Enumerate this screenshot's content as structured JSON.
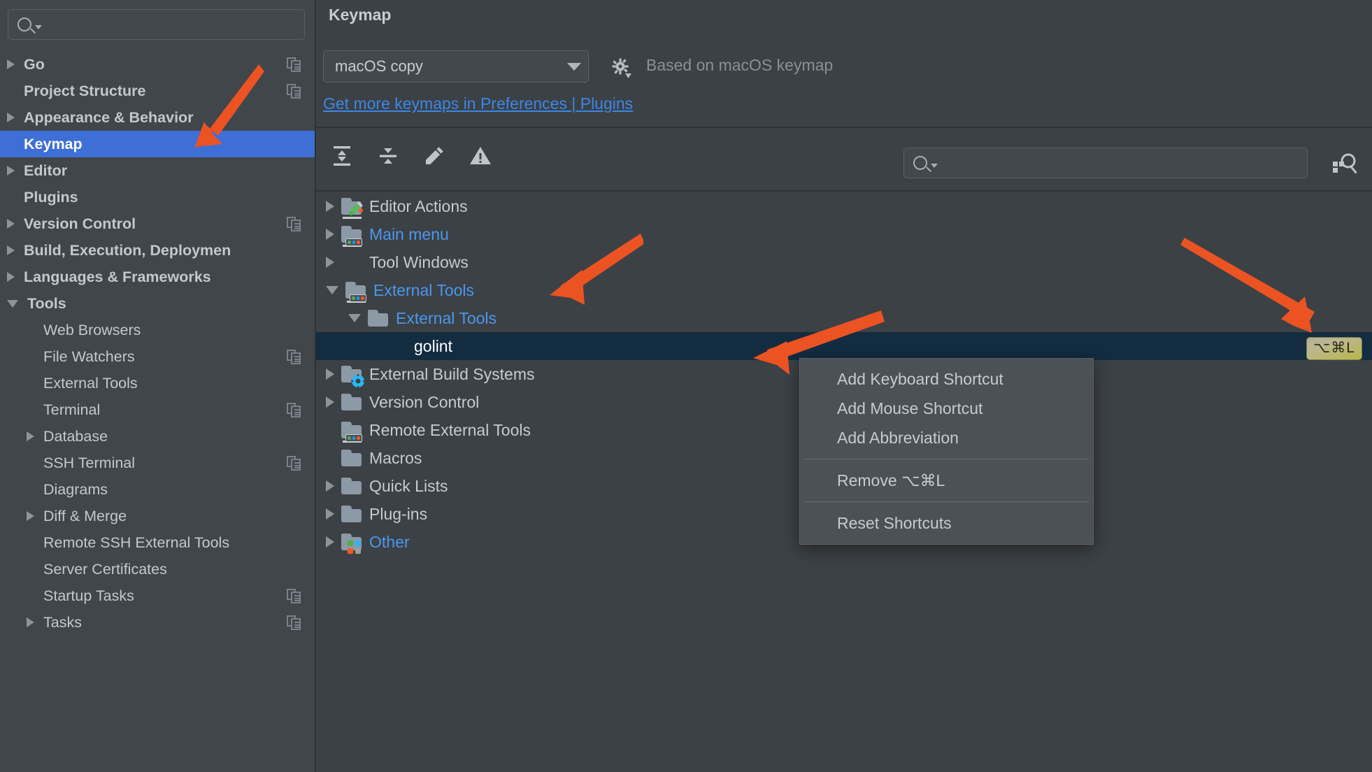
{
  "accent": {
    "selection_blue": "#3d6fd6",
    "tree_selection_navy": "#132c40",
    "link_blue": "#3b87e8",
    "tree_blue": "#4b97ec",
    "annotation_orange": "#ec5323",
    "badge_olive": "#b7b74a"
  },
  "sidebar": {
    "search_placeholder": "",
    "search_icon": "search-icon",
    "items": [
      {
        "label": "Go",
        "twisty": "closed",
        "indent": 0,
        "bold": true,
        "copy": true,
        "selected": false
      },
      {
        "label": "Project Structure",
        "twisty": "none",
        "indent": 0,
        "bold": true,
        "copy": true,
        "selected": false
      },
      {
        "label": "Appearance & Behavior",
        "twisty": "closed",
        "indent": 0,
        "bold": true,
        "copy": false,
        "selected": false
      },
      {
        "label": "Keymap",
        "twisty": "none",
        "indent": 0,
        "bold": true,
        "copy": false,
        "selected": true
      },
      {
        "label": "Editor",
        "twisty": "closed",
        "indent": 0,
        "bold": true,
        "copy": false,
        "selected": false
      },
      {
        "label": "Plugins",
        "twisty": "none",
        "indent": 0,
        "bold": true,
        "copy": false,
        "selected": false
      },
      {
        "label": "Version Control",
        "twisty": "closed",
        "indent": 0,
        "bold": true,
        "copy": true,
        "selected": false
      },
      {
        "label": "Build, Execution, Deploymen",
        "twisty": "closed",
        "indent": 0,
        "bold": true,
        "copy": false,
        "selected": false
      },
      {
        "label": "Languages & Frameworks",
        "twisty": "closed",
        "indent": 0,
        "bold": true,
        "copy": false,
        "selected": false
      },
      {
        "label": "Tools",
        "twisty": "open",
        "indent": 0,
        "bold": true,
        "copy": false,
        "selected": false
      },
      {
        "label": "Web Browsers",
        "twisty": "none",
        "indent": 1,
        "bold": false,
        "copy": false,
        "selected": false
      },
      {
        "label": "File Watchers",
        "twisty": "none",
        "indent": 1,
        "bold": false,
        "copy": true,
        "selected": false
      },
      {
        "label": "External Tools",
        "twisty": "none",
        "indent": 1,
        "bold": false,
        "copy": false,
        "selected": false
      },
      {
        "label": "Terminal",
        "twisty": "none",
        "indent": 1,
        "bold": false,
        "copy": true,
        "selected": false
      },
      {
        "label": "Database",
        "twisty": "closed",
        "indent": 1,
        "bold": false,
        "copy": false,
        "selected": false
      },
      {
        "label": "SSH Terminal",
        "twisty": "none",
        "indent": 1,
        "bold": false,
        "copy": true,
        "selected": false
      },
      {
        "label": "Diagrams",
        "twisty": "none",
        "indent": 1,
        "bold": false,
        "copy": false,
        "selected": false
      },
      {
        "label": "Diff & Merge",
        "twisty": "closed",
        "indent": 1,
        "bold": false,
        "copy": false,
        "selected": false
      },
      {
        "label": "Remote SSH External Tools",
        "twisty": "none",
        "indent": 1,
        "bold": false,
        "copy": false,
        "selected": false
      },
      {
        "label": "Server Certificates",
        "twisty": "none",
        "indent": 1,
        "bold": false,
        "copy": false,
        "selected": false
      },
      {
        "label": "Startup Tasks",
        "twisty": "none",
        "indent": 1,
        "bold": false,
        "copy": true,
        "selected": false
      },
      {
        "label": "Tasks",
        "twisty": "closed",
        "indent": 1,
        "bold": false,
        "copy": true,
        "selected": false
      }
    ]
  },
  "header": {
    "title": "Keymap",
    "keymap_value": "macOS copy",
    "gear_icon": "gear-icon",
    "based_on": "Based on macOS keymap",
    "plugins_link": "Get more keymaps in Preferences | Plugins"
  },
  "toolbar": {
    "buttons": [
      {
        "name": "expand-all-icon",
        "title": "Expand All"
      },
      {
        "name": "collapse-all-icon",
        "title": "Collapse All"
      },
      {
        "name": "edit-pencil-icon",
        "title": "Edit Shortcut"
      },
      {
        "name": "warning-icon",
        "title": "Find Conflicts"
      }
    ],
    "search_placeholder": "",
    "search_icon": "search-icon",
    "find_by_shortcut_icon": "find-by-shortcut-icon"
  },
  "tree": {
    "rows": [
      {
        "label": "Editor Actions",
        "twisty": "closed",
        "indent": 0,
        "style": "normal",
        "deco": "pencil",
        "shortcut": ""
      },
      {
        "label": "Main menu",
        "twisty": "closed",
        "indent": 0,
        "style": "blue",
        "deco": "dots",
        "shortcut": ""
      },
      {
        "label": "Tool Windows",
        "twisty": "closed",
        "indent": 0,
        "style": "normal",
        "deco": "none",
        "shortcut": ""
      },
      {
        "label": "External Tools",
        "twisty": "open",
        "indent": 0,
        "style": "blue",
        "deco": "dots",
        "shortcut": ""
      },
      {
        "label": "External Tools",
        "twisty": "open",
        "indent": 1,
        "style": "blue",
        "deco": "plain",
        "shortcut": ""
      },
      {
        "label": "golint",
        "twisty": "none",
        "indent": 2,
        "style": "selected",
        "deco": "none",
        "shortcut": "⌥⌘L"
      },
      {
        "label": "External Build Systems",
        "twisty": "closed",
        "indent": 0,
        "style": "normal",
        "deco": "gear",
        "shortcut": ""
      },
      {
        "label": "Version Control",
        "twisty": "closed",
        "indent": 0,
        "style": "normal",
        "deco": "plain",
        "shortcut": ""
      },
      {
        "label": "Remote External Tools",
        "twisty": "none",
        "indent": 0,
        "style": "normal",
        "deco": "dots",
        "shortcut": ""
      },
      {
        "label": "Macros",
        "twisty": "none",
        "indent": 0,
        "style": "normal",
        "deco": "plain",
        "shortcut": ""
      },
      {
        "label": "Quick Lists",
        "twisty": "closed",
        "indent": 0,
        "style": "normal",
        "deco": "plain",
        "shortcut": ""
      },
      {
        "label": "Plug-ins",
        "twisty": "closed",
        "indent": 0,
        "style": "normal",
        "deco": "plain",
        "shortcut": ""
      },
      {
        "label": "Other",
        "twisty": "closed",
        "indent": 0,
        "style": "blue",
        "deco": "quad",
        "shortcut": ""
      }
    ]
  },
  "context_menu": {
    "items": [
      {
        "label": "Add Keyboard Shortcut",
        "separator_after": false
      },
      {
        "label": "Add Mouse Shortcut",
        "separator_after": false
      },
      {
        "label": "Add Abbreviation",
        "separator_after": true
      },
      {
        "label": "Remove ⌥⌘L",
        "separator_after": true
      },
      {
        "label": "Reset Shortcuts",
        "separator_after": false
      }
    ]
  },
  "annotations": [
    {
      "name": "arrow-to-keymap-sidebar"
    },
    {
      "name": "arrow-to-external-tools-node"
    },
    {
      "name": "arrow-to-add-keyboard-shortcut"
    },
    {
      "name": "arrow-to-shortcut-badge"
    }
  ]
}
